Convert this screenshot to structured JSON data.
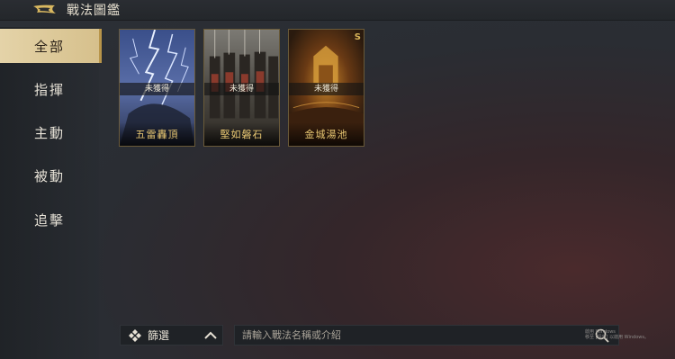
{
  "header": {
    "title": "戰法圖鑑"
  },
  "sidebar": {
    "items": [
      {
        "label": "全部",
        "active": true
      },
      {
        "label": "指揮",
        "active": false
      },
      {
        "label": "主動",
        "active": false
      },
      {
        "label": "被動",
        "active": false
      },
      {
        "label": "追擊",
        "active": false
      }
    ]
  },
  "cards": [
    {
      "name": "五雷轟頂",
      "status": "未獲得",
      "badge": ""
    },
    {
      "name": "堅如磐石",
      "status": "未獲得",
      "badge": ""
    },
    {
      "name": "金城湯池",
      "status": "未獲得",
      "badge": "S"
    }
  ],
  "filter": {
    "label": "篩選"
  },
  "search": {
    "placeholder": "請輸入戰法名稱或介紹"
  },
  "watermark": {
    "line1": "啟用 Windows",
    "line2": "移至 [設定] 以啟用 Windows。"
  },
  "colors": {
    "accent_gold": "#e8c772",
    "active_tab": "#e4d3a8"
  }
}
